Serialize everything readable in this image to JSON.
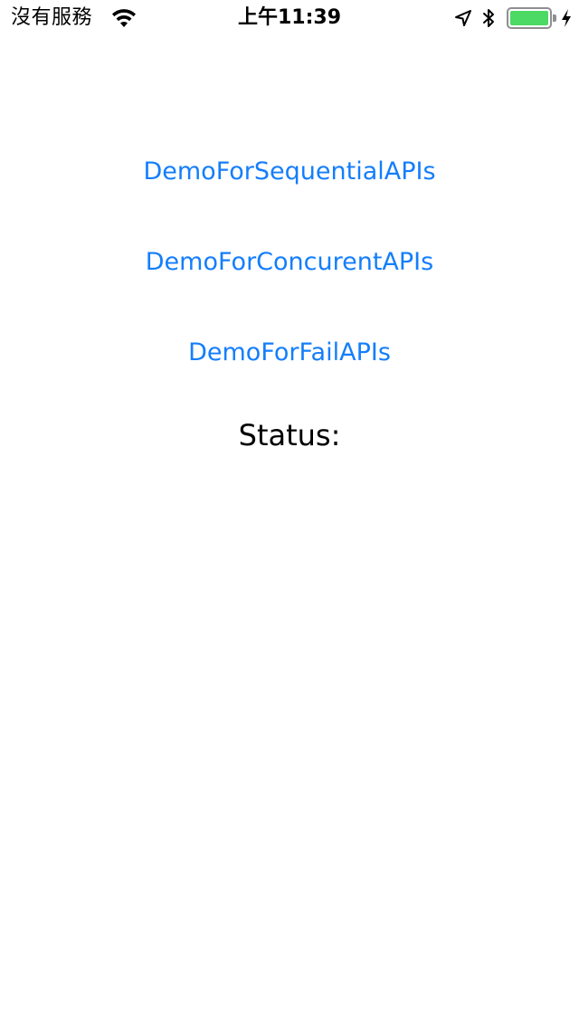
{
  "status_bar": {
    "carrier": "沒有服務",
    "time": "上午11:39",
    "battery_color": "#4cd964",
    "icons": [
      "wifi-icon",
      "location-icon",
      "bluetooth-icon",
      "battery-icon",
      "charging-icon"
    ]
  },
  "main": {
    "buttons": [
      {
        "label": "DemoForSequentialAPIs"
      },
      {
        "label": "DemoForConcurentAPIs"
      },
      {
        "label": "DemoForFailAPIs"
      }
    ],
    "status_label": "Status:",
    "accent_color": "#147efb"
  }
}
